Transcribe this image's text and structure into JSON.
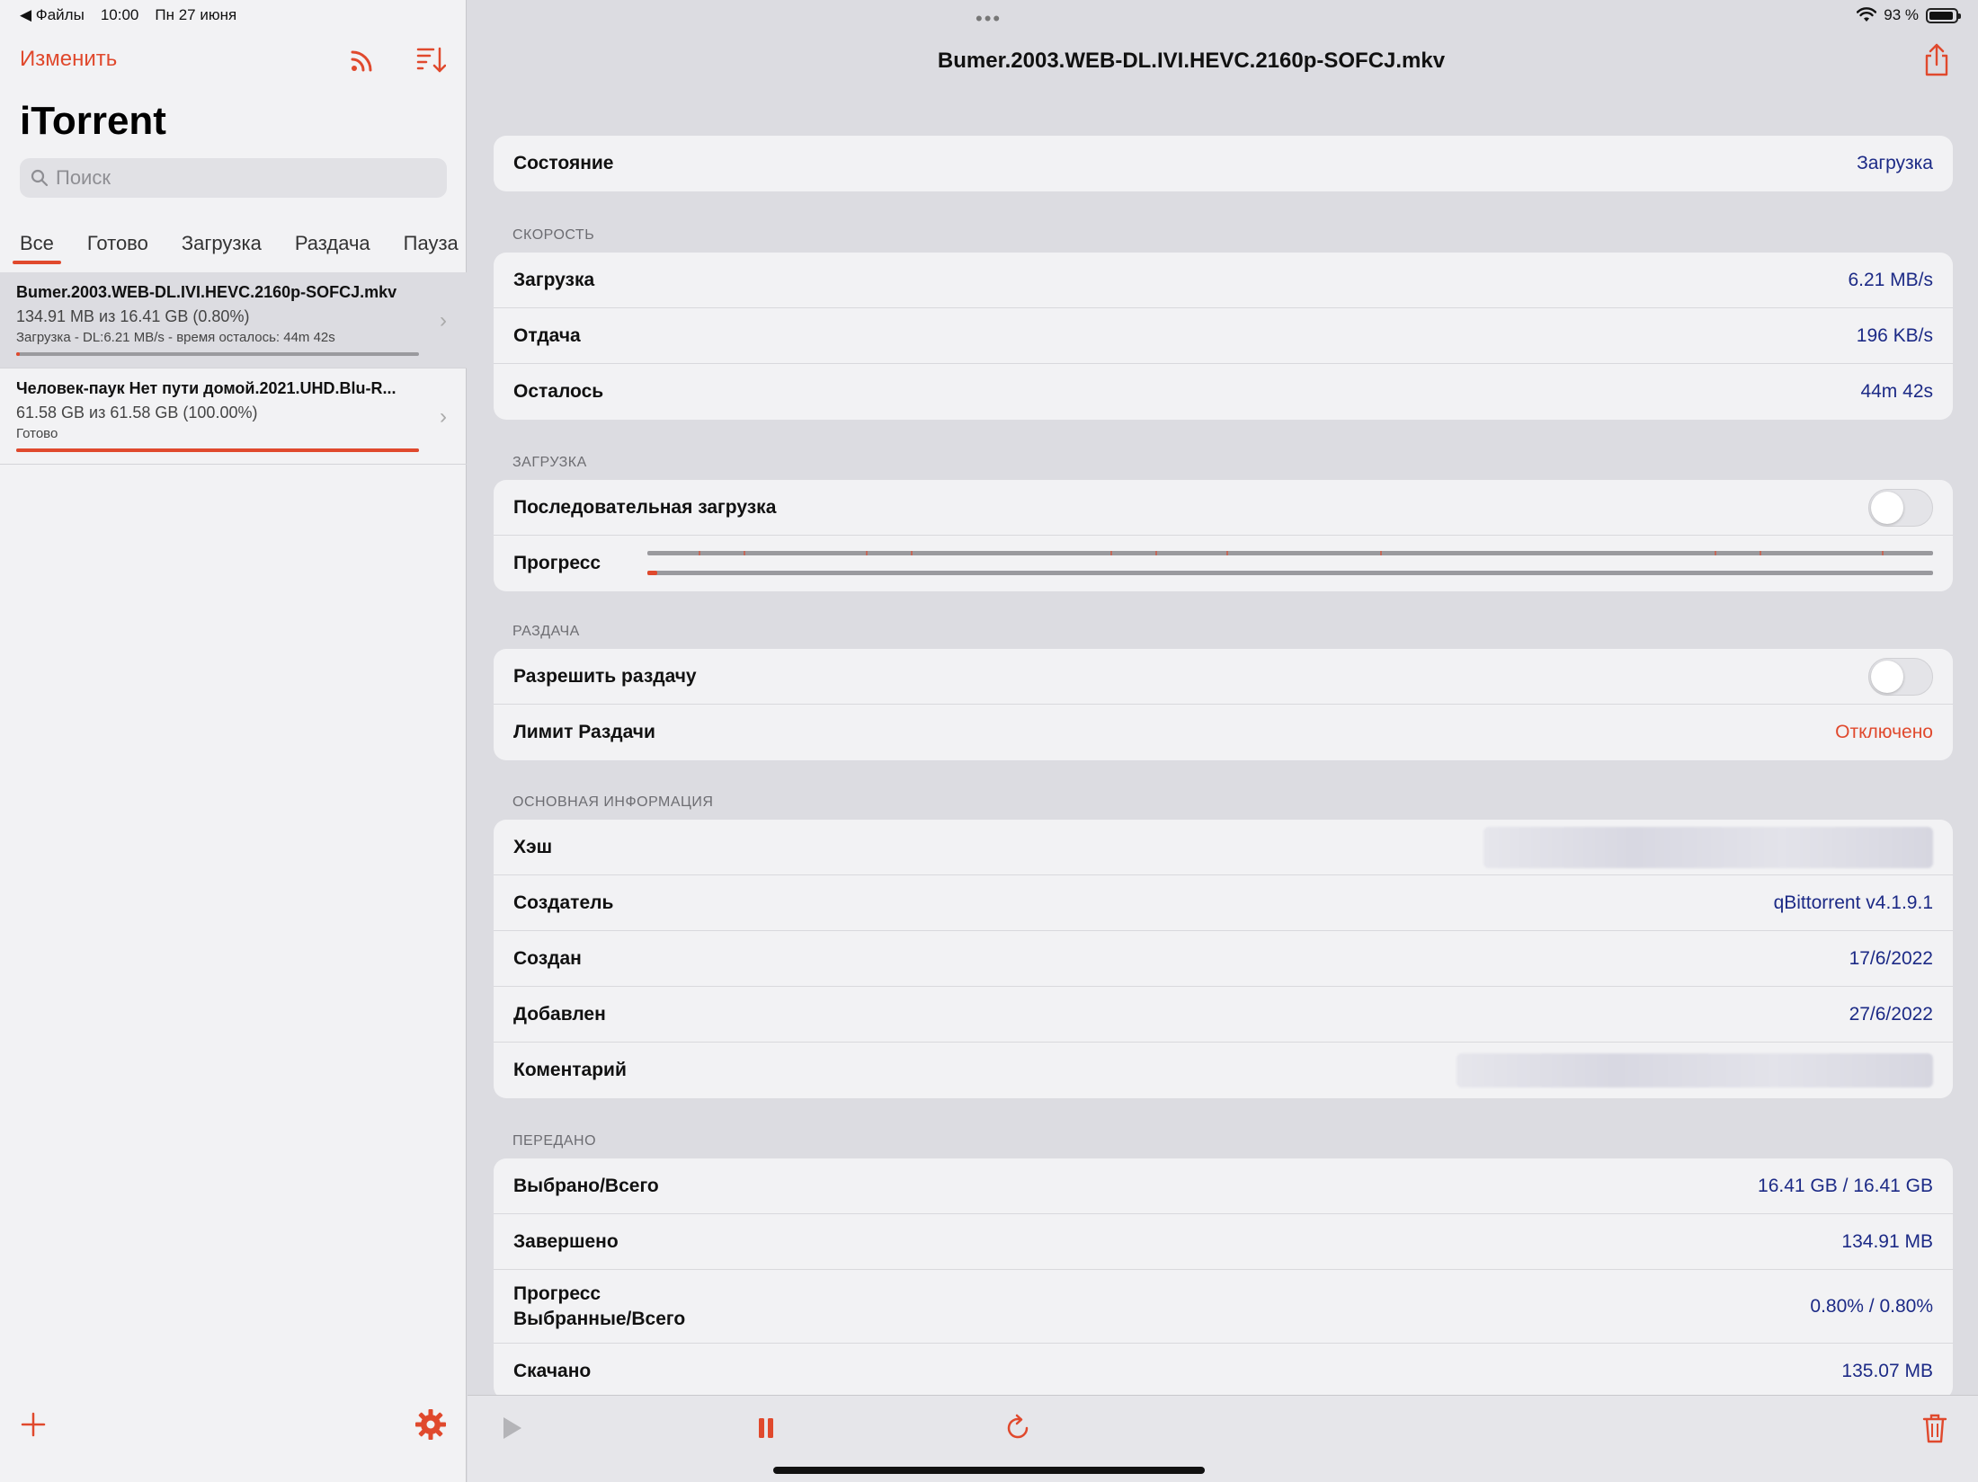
{
  "status_bar": {
    "back_app": "◀ Файлы",
    "time": "10:00",
    "date": "Пн 27 июня",
    "battery": "93 %",
    "battery_level": 0.93
  },
  "sidebar": {
    "edit_label": "Изменить",
    "title": "iTorrent",
    "search_placeholder": "Поиск",
    "tabs": [
      {
        "label": "Все",
        "active": true
      },
      {
        "label": "Готово",
        "active": false
      },
      {
        "label": "Загрузка",
        "active": false
      },
      {
        "label": "Раздача",
        "active": false
      },
      {
        "label": "Пауза",
        "active": false
      }
    ],
    "torrents": [
      {
        "name": "Bumer.2003.WEB-DL.IVI.HEVC.2160p-SOFCJ.mkv",
        "size": "134.91 MB из 16.41 GB (0.80%)",
        "status": "Загрузка - DL:6.21 MB/s - время осталось: 44m 42s",
        "progress": 0.008,
        "selected": true
      },
      {
        "name": "Человек-паук Нет пути домой.2021.UHD.Blu-R...",
        "size": "61.58 GB из 61.58 GB (100.00%)",
        "status": "Готово",
        "progress": 1.0,
        "selected": false
      }
    ]
  },
  "detail": {
    "title": "Bumer.2003.WEB-DL.IVI.HEVC.2160p-SOFCJ.mkv",
    "state": {
      "label": "Состояние",
      "value": "Загрузка"
    },
    "speed": {
      "header": "СКОРОСТЬ",
      "download": {
        "label": "Загрузка",
        "value": "6.21 MB/s"
      },
      "upload": {
        "label": "Отдача",
        "value": "196 KB/s"
      },
      "remaining": {
        "label": "Осталось",
        "value": "44m 42s"
      }
    },
    "download": {
      "header": "ЗАГРУЗКА",
      "sequential": {
        "label": "Последовательная загрузка",
        "on": false
      },
      "progress": {
        "label": "Прогресс",
        "value": 0.008
      }
    },
    "seeding": {
      "header": "РАЗДАЧА",
      "allow": {
        "label": "Разрешить раздачу",
        "on": false
      },
      "limit": {
        "label": "Лимит Раздачи",
        "value": "Отключено"
      }
    },
    "info": {
      "header": "ОСНОВНАЯ ИНФОРМАЦИЯ",
      "hash": {
        "label": "Хэш"
      },
      "creator": {
        "label": "Создатель",
        "value": "qBittorrent v4.1.9.1"
      },
      "created": {
        "label": "Создан",
        "value": "17/6/2022"
      },
      "added": {
        "label": "Добавлен",
        "value": "27/6/2022"
      },
      "comment": {
        "label": "Коментарий"
      }
    },
    "transferred": {
      "header": "ПЕРЕДАНО",
      "selected_total": {
        "label": "Выбрано/Всего",
        "value": "16.41 GB / 16.41 GB"
      },
      "completed": {
        "label": "Завершено",
        "value": "134.91 MB"
      },
      "progress_sel": {
        "label_line1": "Прогресс",
        "label_line2": "Выбранные/Всего",
        "value": "0.80% / 0.80%"
      },
      "downloaded": {
        "label": "Скачано",
        "value": "135.07 MB"
      }
    }
  },
  "colors": {
    "accent": "#e0492d",
    "value_text": "#1c2a86",
    "background": "#dcdce1",
    "card": "#f2f2f4"
  },
  "icons": {
    "rss": "rss-icon",
    "sort": "sort-icon",
    "search": "search-icon",
    "add": "plus-icon",
    "settings": "gear-icon",
    "share": "share-icon",
    "play": "play-icon",
    "pause": "pause-icon",
    "refresh": "refresh-icon",
    "delete": "trash-icon"
  }
}
